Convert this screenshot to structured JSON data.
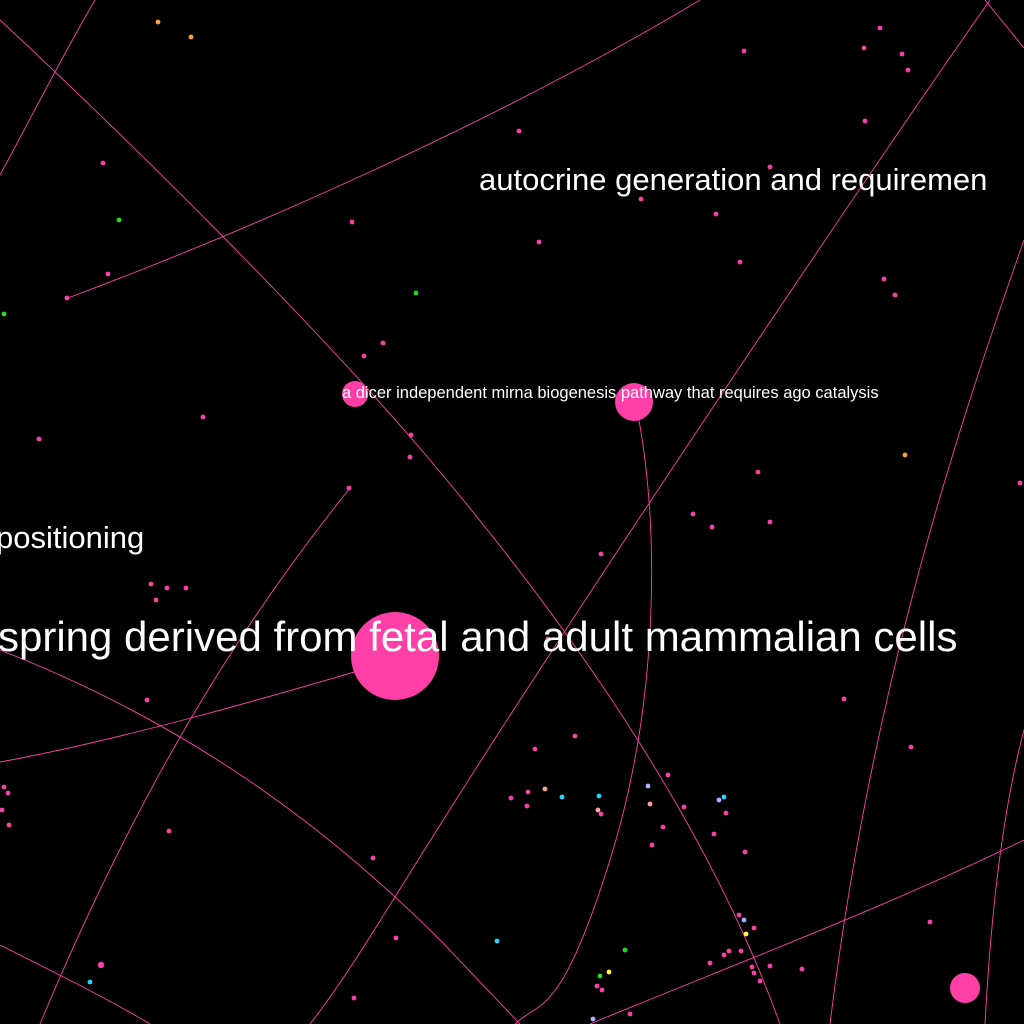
{
  "labels": {
    "dicer": "a dicer independent mirna biogenesis pathway that requires ago catalysis",
    "autocrine": "autocrine generation and requiremen",
    "offspring": "spring derived from fetal and adult mammalian cells",
    "positioning": "positioning"
  },
  "colors": {
    "background": "#000000",
    "edge": "#ff3fa8",
    "node": "#ff3fa8",
    "label": "#ffffff"
  }
}
